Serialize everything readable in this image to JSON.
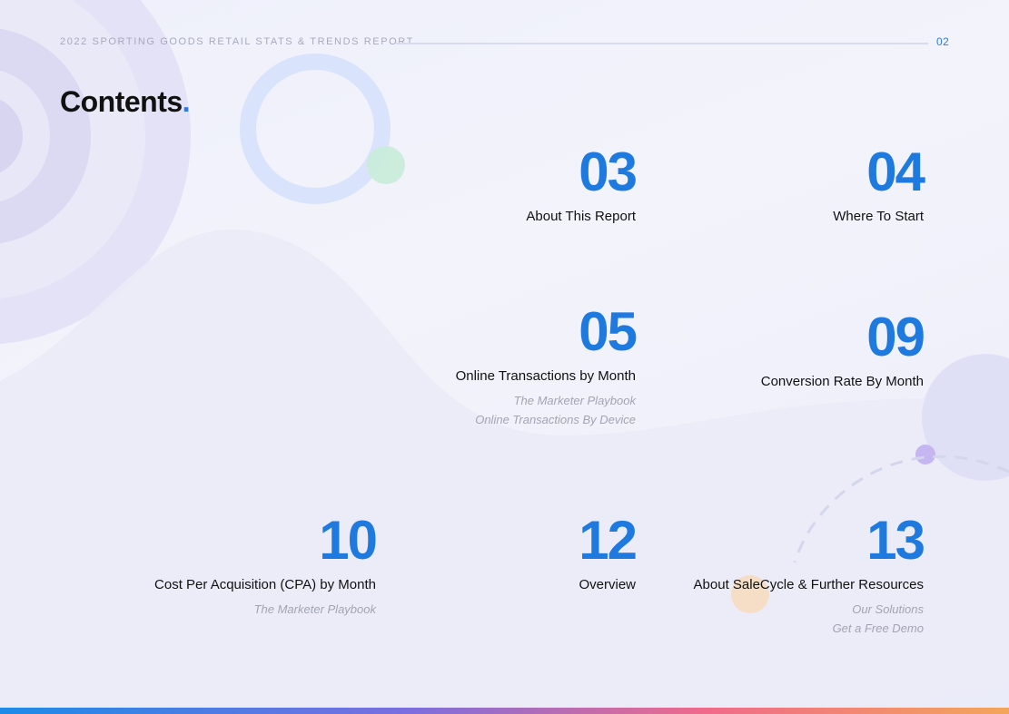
{
  "header": {
    "report_title": "2022 SPORTING GOODS RETAIL STATS & TRENDS REPORT",
    "page_number": "02"
  },
  "contents": {
    "title": "Contents",
    "title_dot": "."
  },
  "entries": [
    {
      "number": "03",
      "label": "About This Report",
      "subs": []
    },
    {
      "number": "04",
      "label": "Where To Start",
      "subs": []
    },
    {
      "number": "05",
      "label": "Online Transactions by Month",
      "subs": [
        "The Marketer Playbook",
        "Online Transactions By Device"
      ]
    },
    {
      "number": "09",
      "label": "Conversion Rate By Month",
      "subs": []
    },
    {
      "number": "10",
      "label": "Cost Per Acquisition (CPA) by Month",
      "subs": [
        "The Marketer Playbook"
      ]
    },
    {
      "number": "12",
      "label": "Overview",
      "subs": []
    },
    {
      "number": "13",
      "label": "About SaleCycle & Further Resources",
      "subs": [
        "Our Solutions",
        "Get a Free Demo"
      ]
    }
  ],
  "colors": {
    "accent_blue": "#1f7ae0",
    "text_dark": "#111111",
    "muted_gray": "#a2a4b2"
  }
}
